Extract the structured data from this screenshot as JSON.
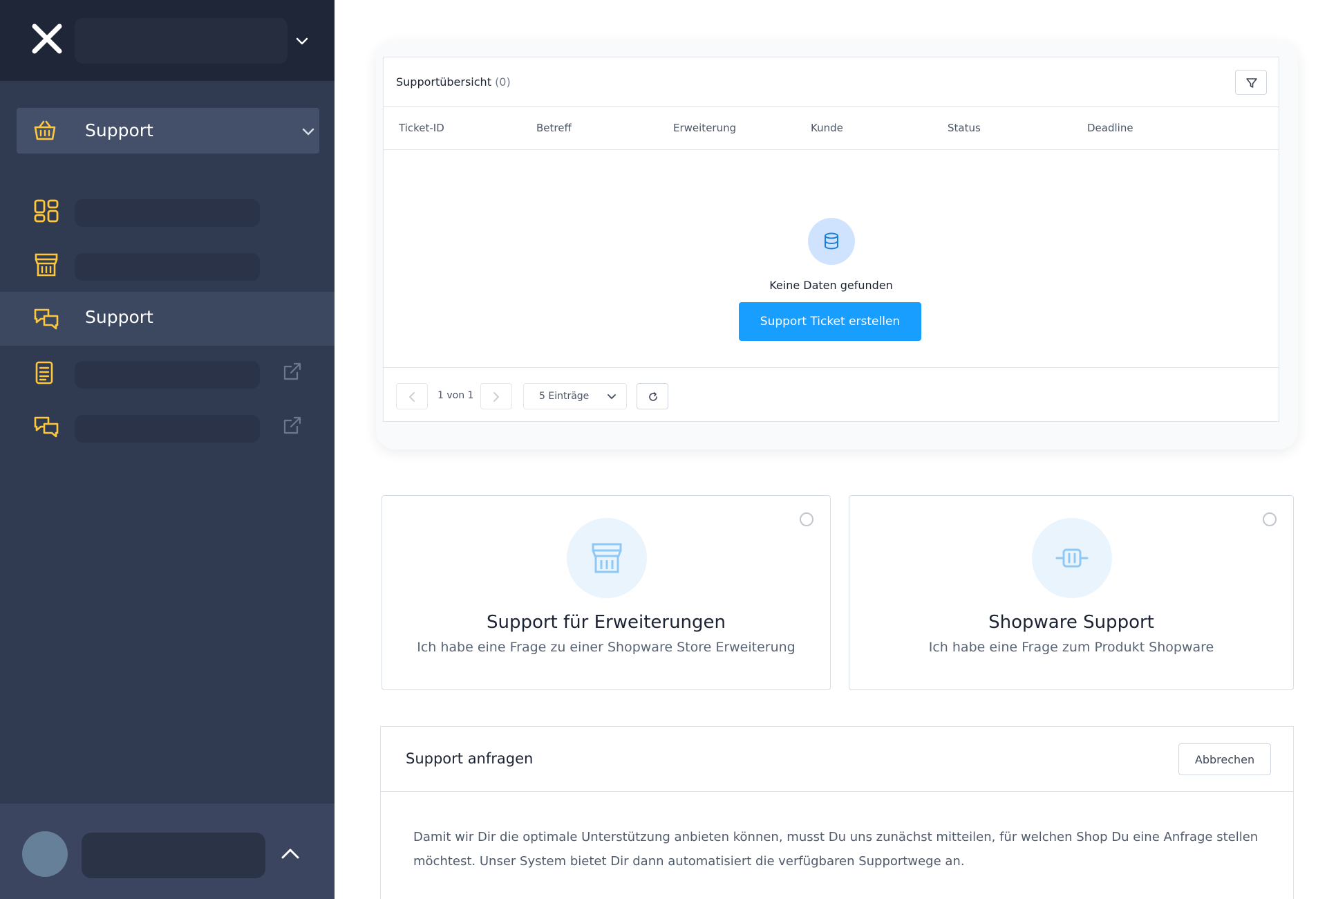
{
  "sidebar": {
    "main_menu": {
      "label": "Support",
      "icon": "basket-icon"
    },
    "items": [
      {
        "icon": "dashboard-icon",
        "label": ""
      },
      {
        "icon": "store-icon",
        "label": ""
      },
      {
        "icon": "chat-icon",
        "label": "Support",
        "active": true
      },
      {
        "icon": "document-icon",
        "label": "",
        "external": true
      },
      {
        "icon": "chat-icon",
        "label": "",
        "external": true
      }
    ]
  },
  "ticket_overview": {
    "title": "Supportübersicht",
    "count": "(0)",
    "columns": [
      "Ticket-ID",
      "Betreff",
      "Erweiterung",
      "Kunde",
      "Status",
      "Deadline"
    ],
    "empty_text": "Keine Daten gefunden",
    "create_button": "Support Ticket erstellen",
    "pagination": {
      "text": "1 von 1",
      "per_page": "5 Einträge"
    }
  },
  "options": [
    {
      "title": "Support für Erweiterungen",
      "description": "Ich habe eine Frage zu einer Shopware Store Erweiterung",
      "icon": "store-icon"
    },
    {
      "title": "Shopware Support",
      "description": "Ich habe eine Frage zum Produkt Shopware",
      "icon": "plugin-icon"
    }
  ],
  "support_request": {
    "title": "Support anfragen",
    "cancel_button": "Abbrechen",
    "body": "Damit wir Dir die optimale Unterstützung anbieten können, musst Du uns zunächst mitteilen, für welchen Shop Du eine Anfrage stellen möchtest. Unser System bietet Dir dann automatisiert die verfügbaren Supportwege an."
  },
  "colors": {
    "sidebar_bg": "#303a50",
    "sidebar_header_bg": "#1f2637",
    "icon_yellow": "#ffc83c",
    "primary_blue": "#189eff"
  }
}
